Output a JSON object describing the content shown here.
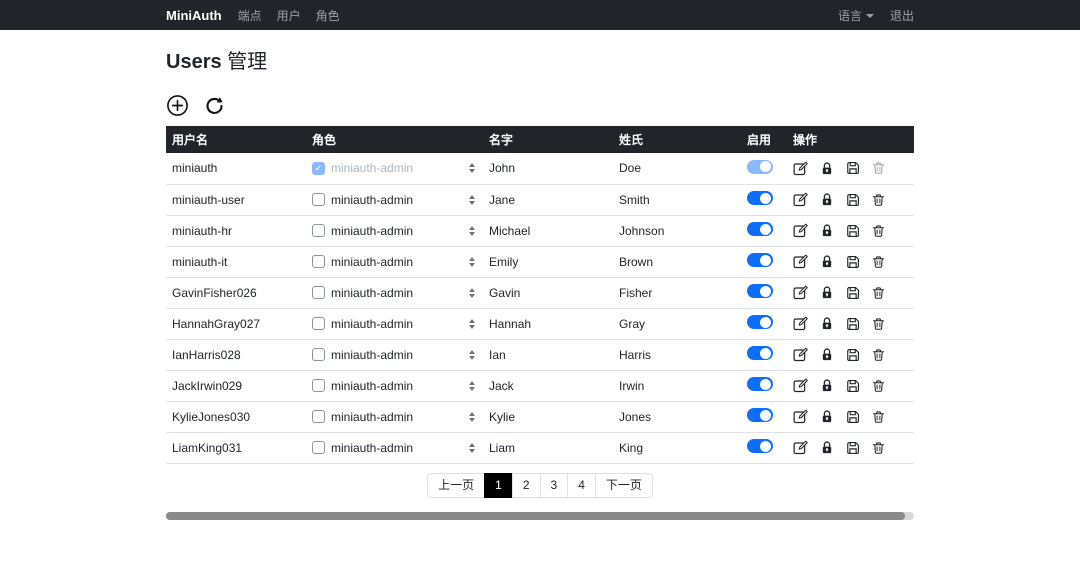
{
  "navbar": {
    "brand": "MiniAuth",
    "links": [
      {
        "id": "endpoints",
        "label": "端点"
      },
      {
        "id": "users",
        "label": "用户"
      },
      {
        "id": "roles",
        "label": "角色"
      }
    ],
    "language": "语言",
    "logout": "退出"
  },
  "page": {
    "title_main": "Users",
    "title_suffix": "管理"
  },
  "toolbar": {
    "add_icon": "plus-circle-icon",
    "refresh_icon": "refresh-icon"
  },
  "table": {
    "headers": [
      "用户名",
      "角色",
      "名字",
      "姓氏",
      "启用",
      "操作"
    ],
    "role_option": "miniauth-admin",
    "action_icons": [
      "edit-icon",
      "lock-icon",
      "save-icon",
      "trash-icon"
    ],
    "rows": [
      {
        "username": "miniauth",
        "role_checked": true,
        "first": "John",
        "last": "Doe",
        "enabled": true,
        "locked": true
      },
      {
        "username": "miniauth-user",
        "role_checked": false,
        "first": "Jane",
        "last": "Smith",
        "enabled": true,
        "locked": false
      },
      {
        "username": "miniauth-hr",
        "role_checked": false,
        "first": "Michael",
        "last": "Johnson",
        "enabled": true,
        "locked": false
      },
      {
        "username": "miniauth-it",
        "role_checked": false,
        "first": "Emily",
        "last": "Brown",
        "enabled": true,
        "locked": false
      },
      {
        "username": "GavinFisher026",
        "role_checked": false,
        "first": "Gavin",
        "last": "Fisher",
        "enabled": true,
        "locked": false
      },
      {
        "username": "HannahGray027",
        "role_checked": false,
        "first": "Hannah",
        "last": "Gray",
        "enabled": true,
        "locked": false
      },
      {
        "username": "IanHarris028",
        "role_checked": false,
        "first": "Ian",
        "last": "Harris",
        "enabled": true,
        "locked": false
      },
      {
        "username": "JackIrwin029",
        "role_checked": false,
        "first": "Jack",
        "last": "Irwin",
        "enabled": true,
        "locked": false
      },
      {
        "username": "KylieJones030",
        "role_checked": false,
        "first": "Kylie",
        "last": "Jones",
        "enabled": true,
        "locked": false
      },
      {
        "username": "LiamKing031",
        "role_checked": false,
        "first": "Liam",
        "last": "King",
        "enabled": true,
        "locked": false
      }
    ]
  },
  "pagination": {
    "prev": "上一页",
    "pages": [
      "1",
      "2",
      "3",
      "4"
    ],
    "active": "1",
    "next": "下一页"
  },
  "colors": {
    "navbar_bg": "#212529",
    "table_header_bg": "#212529",
    "accent_blue": "#0d6efd",
    "disabled_blue": "#8bb9fe",
    "row_border": "#dee2e6",
    "active_page_bg": "#000000",
    "scrollbar_thumb": "#8a8a8a"
  }
}
